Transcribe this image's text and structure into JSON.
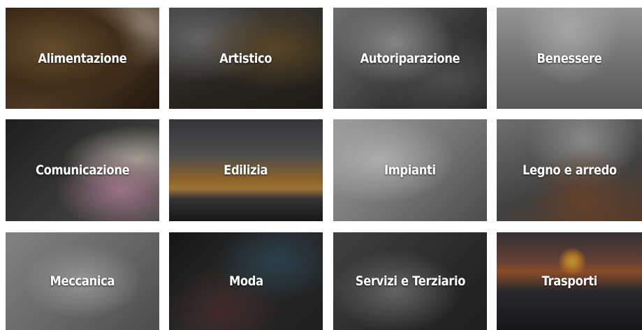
{
  "categories": [
    {
      "label": "Alimentazione"
    },
    {
      "label": "Artistico"
    },
    {
      "label": "Autoriparazione"
    },
    {
      "label": "Benessere"
    },
    {
      "label": "Comunicazione"
    },
    {
      "label": "Edilizia"
    },
    {
      "label": "Impianti"
    },
    {
      "label": "Legno e arredo"
    },
    {
      "label": "Meccanica"
    },
    {
      "label": "Moda"
    },
    {
      "label": "Servizi e Terziario"
    },
    {
      "label": "Trasporti"
    }
  ]
}
